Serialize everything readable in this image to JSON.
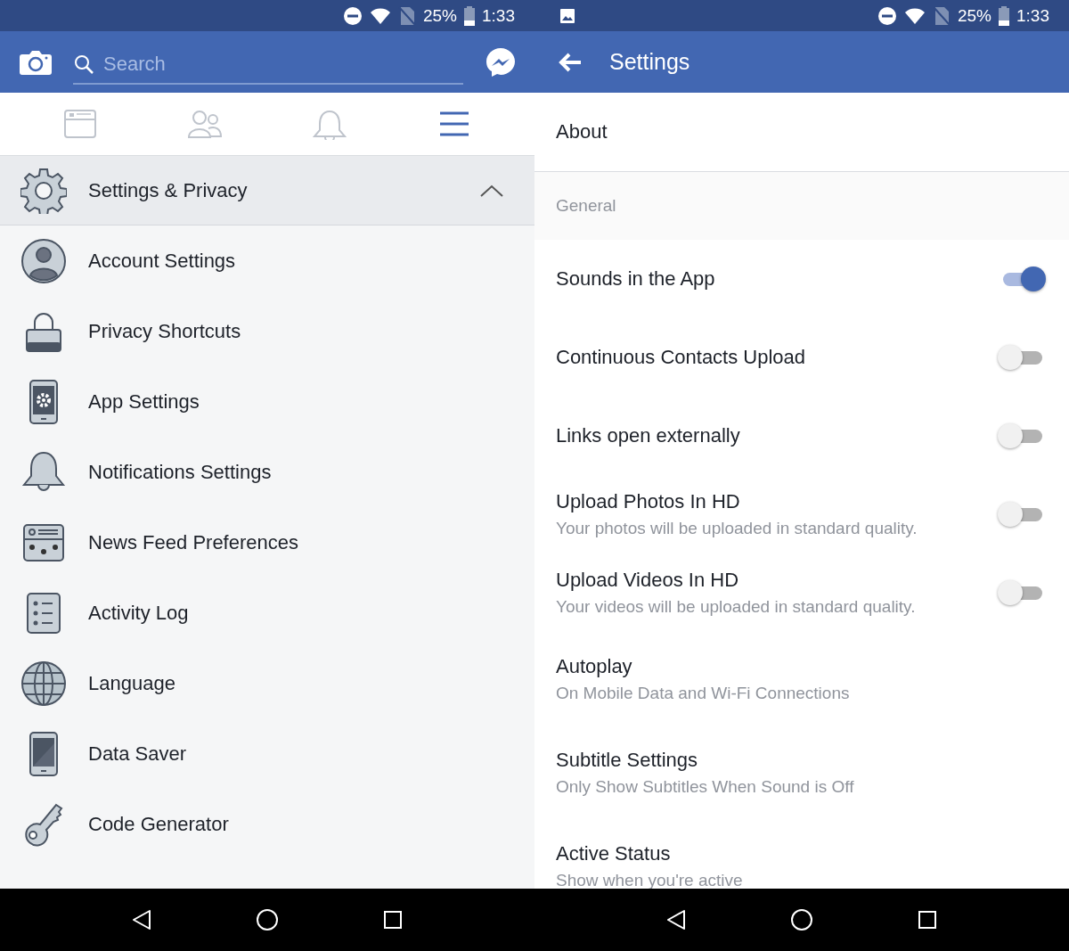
{
  "left_screen": {
    "status_bar": {
      "battery": "25%",
      "time": "1:33"
    },
    "search": {
      "placeholder": "Search"
    },
    "tabs": [
      {
        "kind": "feed",
        "selected": false
      },
      {
        "kind": "friends",
        "selected": false
      },
      {
        "kind": "bell",
        "selected": false
      },
      {
        "kind": "menu",
        "selected": true
      }
    ],
    "section": {
      "label": "Settings & Privacy",
      "expanded": true
    },
    "items": [
      {
        "kind": "account",
        "label": "Account Settings"
      },
      {
        "kind": "lock",
        "label": "Privacy Shortcuts"
      },
      {
        "kind": "app",
        "label": "App Settings"
      },
      {
        "kind": "bell",
        "label": "Notifications Settings"
      },
      {
        "kind": "feed",
        "label": "News Feed Preferences"
      },
      {
        "kind": "log",
        "label": "Activity Log"
      },
      {
        "kind": "globe",
        "label": "Language"
      },
      {
        "kind": "phone",
        "label": "Data Saver"
      },
      {
        "kind": "key",
        "label": "Code Generator"
      }
    ]
  },
  "right_screen": {
    "status_bar": {
      "battery": "25%",
      "time": "1:33"
    },
    "title": "Settings",
    "about": "About",
    "section": "General",
    "rows": [
      {
        "kind": "toggle",
        "title": "Sounds in the App",
        "on": true
      },
      {
        "kind": "toggle",
        "title": "Continuous Contacts Upload",
        "on": false
      },
      {
        "kind": "toggle",
        "title": "Links open externally",
        "on": false
      },
      {
        "kind": "toggle",
        "title": "Upload Photos In HD",
        "subtitle": "Your photos will be uploaded in standard quality.",
        "on": false
      },
      {
        "kind": "toggle",
        "title": "Upload Videos In HD",
        "subtitle": "Your videos will be uploaded in standard quality.",
        "on": false
      },
      {
        "kind": "text",
        "title": "Autoplay",
        "subtitle": "On Mobile Data and Wi-Fi Connections"
      },
      {
        "kind": "text",
        "title": "Subtitle Settings",
        "subtitle": "Only Show Subtitles When Sound is Off"
      },
      {
        "kind": "text",
        "title": "Active Status",
        "subtitle": "Show when you're active"
      }
    ]
  }
}
